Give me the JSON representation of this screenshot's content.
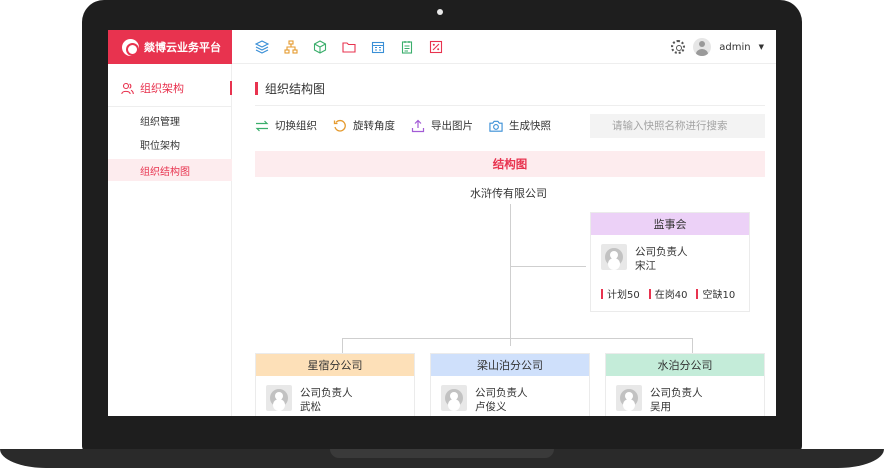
{
  "brand": {
    "title": "燚博云业务平台"
  },
  "header": {
    "toolbar_icons": [
      "layers-icon",
      "org-tree-icon",
      "cube-icon",
      "folder-icon",
      "calendar-icon",
      "document-icon",
      "percent-icon"
    ],
    "user_name": "admin"
  },
  "sidebar": {
    "group_label": "组织架构",
    "items": [
      {
        "label": "组织管理",
        "active": false
      },
      {
        "label": "职位架构",
        "active": false
      },
      {
        "label": "组织结构图",
        "active": true
      }
    ]
  },
  "main": {
    "page_title": "组织结构图",
    "toolbar": [
      {
        "label": "切换组织",
        "icon": "switch-icon"
      },
      {
        "label": "旋转角度",
        "icon": "rotate-icon"
      },
      {
        "label": "导出图片",
        "icon": "export-icon"
      },
      {
        "label": "生成快照",
        "icon": "camera-icon"
      }
    ],
    "search_placeholder": "请输入快照名称进行搜索",
    "chart_title": "结构图",
    "root": "水浒传有限公司",
    "supervisor": {
      "name": "监事会",
      "role": "公司负责人",
      "person": "宋江",
      "stats": [
        "计划50",
        "在岗40",
        "空缺10"
      ]
    },
    "branches": [
      {
        "name": "星宿分公司",
        "role": "公司负责人",
        "person": "武松"
      },
      {
        "name": "梁山泊分公司",
        "role": "公司负责人",
        "person": "卢俊义"
      },
      {
        "name": "水泊分公司",
        "role": "公司负责人",
        "person": "吴用"
      }
    ]
  },
  "colors": {
    "accent": "#e8334f",
    "supervisor_head": "#ecd1f7",
    "branch_heads": [
      "#fde0b8",
      "#cfe0fb",
      "#c4ecd9"
    ]
  }
}
